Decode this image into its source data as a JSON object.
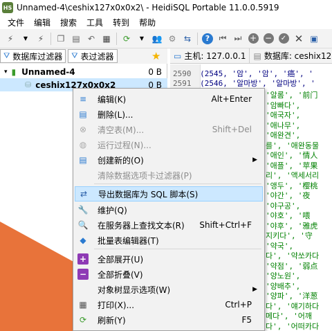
{
  "window": {
    "title": "Unnamed-4\\ceshix127x0x0x2\\ - HeidiSQL Portable 11.0.0.5919",
    "icon_text": "HS"
  },
  "menu": [
    "文件",
    "编辑",
    "搜索",
    "工具",
    "转到",
    "帮助"
  ],
  "filters": {
    "db_filter": "数据库过滤器",
    "table_filter": "表过滤器"
  },
  "tabs": [
    {
      "label": "主机: 127.0.0.1"
    },
    {
      "label": "数据库: ceshix12"
    }
  ],
  "tree": [
    {
      "label": "Unnamed-4",
      "size": "0 B"
    },
    {
      "label": "ceshix127x0x0x2",
      "size": "0 B"
    }
  ],
  "editor": {
    "lines": [
      {
        "num": "2590",
        "code": "(2545, '암', '암', '癌', '"
      },
      {
        "num": "2591",
        "code": "(2546, '알마방', '알마방', '"
      }
    ],
    "fragments": [
      "'알롬', '前门",
      "'암빠다',",
      "'애국자',",
      "'애나무',",
      "'애완견',",
      "를', '애완동물",
      "'애인', '情人",
      "'애플', '苹果",
      "리', '액세서리",
      "'앵두', '樱桃",
      "'야간', '夜",
      "'야구공',",
      "'야호', '喂",
      "'야후', '雅虎",
      "지키다', '守",
      "'약국',",
      "다', '약쏘카다",
      "'약점', '弱点",
      "'양노원',",
      "'양배추',",
      "'양파', '洋葱",
      "다', '얘기하다",
      "메다', '어깨",
      "다', '어떠카다",
      "'어른'",
      ""
    ]
  },
  "context_menu": {
    "items": [
      {
        "label": "编辑(K)",
        "shortcut": "Alt+Enter",
        "icon": "edit-icon",
        "disabled": false
      },
      {
        "label": "删除(L)...",
        "shortcut": "",
        "icon": "delete-icon",
        "disabled": false
      },
      {
        "label": "清空表(M)...",
        "shortcut": "Shift+Del",
        "icon": "empty-table-icon",
        "disabled": true
      },
      {
        "label": "运行过程(N)...",
        "shortcut": "",
        "icon": "run-procedure-icon",
        "disabled": true
      },
      {
        "label": "创建新的(O)",
        "shortcut": "",
        "icon": "create-new-icon",
        "disabled": false,
        "submenu": true
      },
      {
        "label": "清除数据选项卡过滤器(P)",
        "shortcut": "",
        "icon": "",
        "disabled": true
      },
      {
        "label": "导出数据库为 SQL 脚本(S)",
        "shortcut": "",
        "icon": "export-icon",
        "disabled": false,
        "highlighted": true
      },
      {
        "label": "维护(Q)",
        "shortcut": "",
        "icon": "wrench-icon",
        "disabled": false
      },
      {
        "label": "在服务器上查找文本(R)",
        "shortcut": "Shift+Ctrl+F",
        "icon": "search-icon",
        "disabled": false
      },
      {
        "label": "批量表编辑器(T)",
        "shortcut": "",
        "icon": "bulk-edit-icon",
        "disabled": false
      },
      {
        "label": "全部展开(U)",
        "shortcut": "",
        "icon": "expand-all-icon",
        "disabled": false
      },
      {
        "label": "全部折叠(V)",
        "shortcut": "",
        "icon": "collapse-all-icon",
        "disabled": false
      },
      {
        "label": "对象树显示选项(W)",
        "shortcut": "",
        "icon": "",
        "disabled": false,
        "submenu": true
      },
      {
        "label": "打印(X)...",
        "shortcut": "Ctrl+P",
        "icon": "print-icon",
        "disabled": false
      },
      {
        "label": "刷新(Y)",
        "shortcut": "F5",
        "icon": "refresh-icon",
        "disabled": false
      }
    ]
  },
  "colors": {
    "accent": "#cce8ff",
    "orange": "#e8733a",
    "purple": "#8e3ab5"
  }
}
